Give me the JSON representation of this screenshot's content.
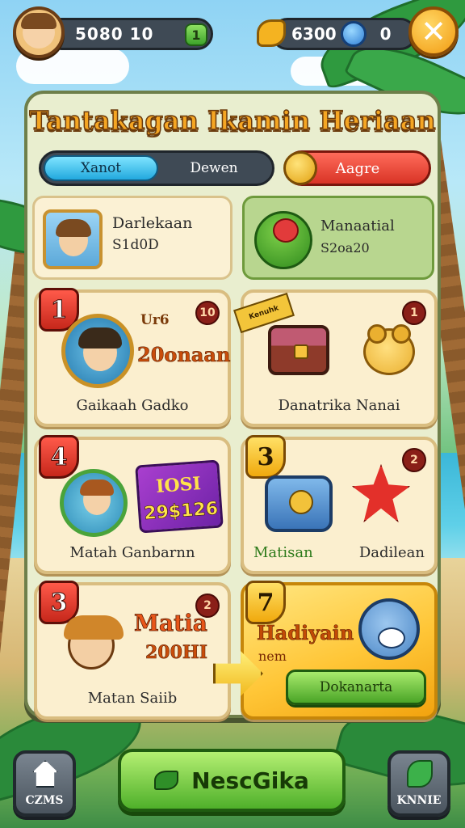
{
  "hud": {
    "coins_value": "5080 10",
    "coins_plus": "1",
    "gems_value": "6300",
    "gems_extra": "0",
    "close_glyph": "✕"
  },
  "panel": {
    "title": "Tantakagan Ikamin Heriaan",
    "tabs": [
      "Xanot",
      "Dewen"
    ],
    "active_tab": "Xanot",
    "right_tab_label": "Aagre"
  },
  "top_cards": {
    "player": {
      "line1": "Darlekaan",
      "line2": "S1d0D"
    },
    "item": {
      "line1": "Manaatial",
      "line2": "S2oa20"
    }
  },
  "cards": [
    {
      "rank": "1",
      "count": "10",
      "tag": "Ur6",
      "big": "20onaan",
      "name": "Gaikaah Gadko"
    },
    {
      "count": "1",
      "ribbon": "Kenuhk",
      "name": "Danatrika Nanai"
    },
    {
      "rank": "4",
      "ticket_top": "IOSI",
      "ticket_value": "29$126",
      "name": "Matah Ganbarnn"
    },
    {
      "rank": "3",
      "count": "2",
      "left_label": "Matisan",
      "right_label": "Dadilean"
    },
    {
      "rank": "3",
      "count": "2",
      "tag": "Matia",
      "big": "200HI",
      "name": "Matan Saiib"
    },
    {
      "rank": "7",
      "tag": "Hadiyain",
      "sub": "nem",
      "button": "Dokanarta"
    }
  ],
  "bottom": {
    "left_label": "CZMS",
    "main_button": "NescGika",
    "right_label": "KNNIE"
  },
  "colors": {
    "panel_bg": "#e9eecf",
    "title": "#f5a623",
    "accent_green": "#4fb02a",
    "accent_red": "#d93426",
    "tab_active": "#22a9de"
  }
}
